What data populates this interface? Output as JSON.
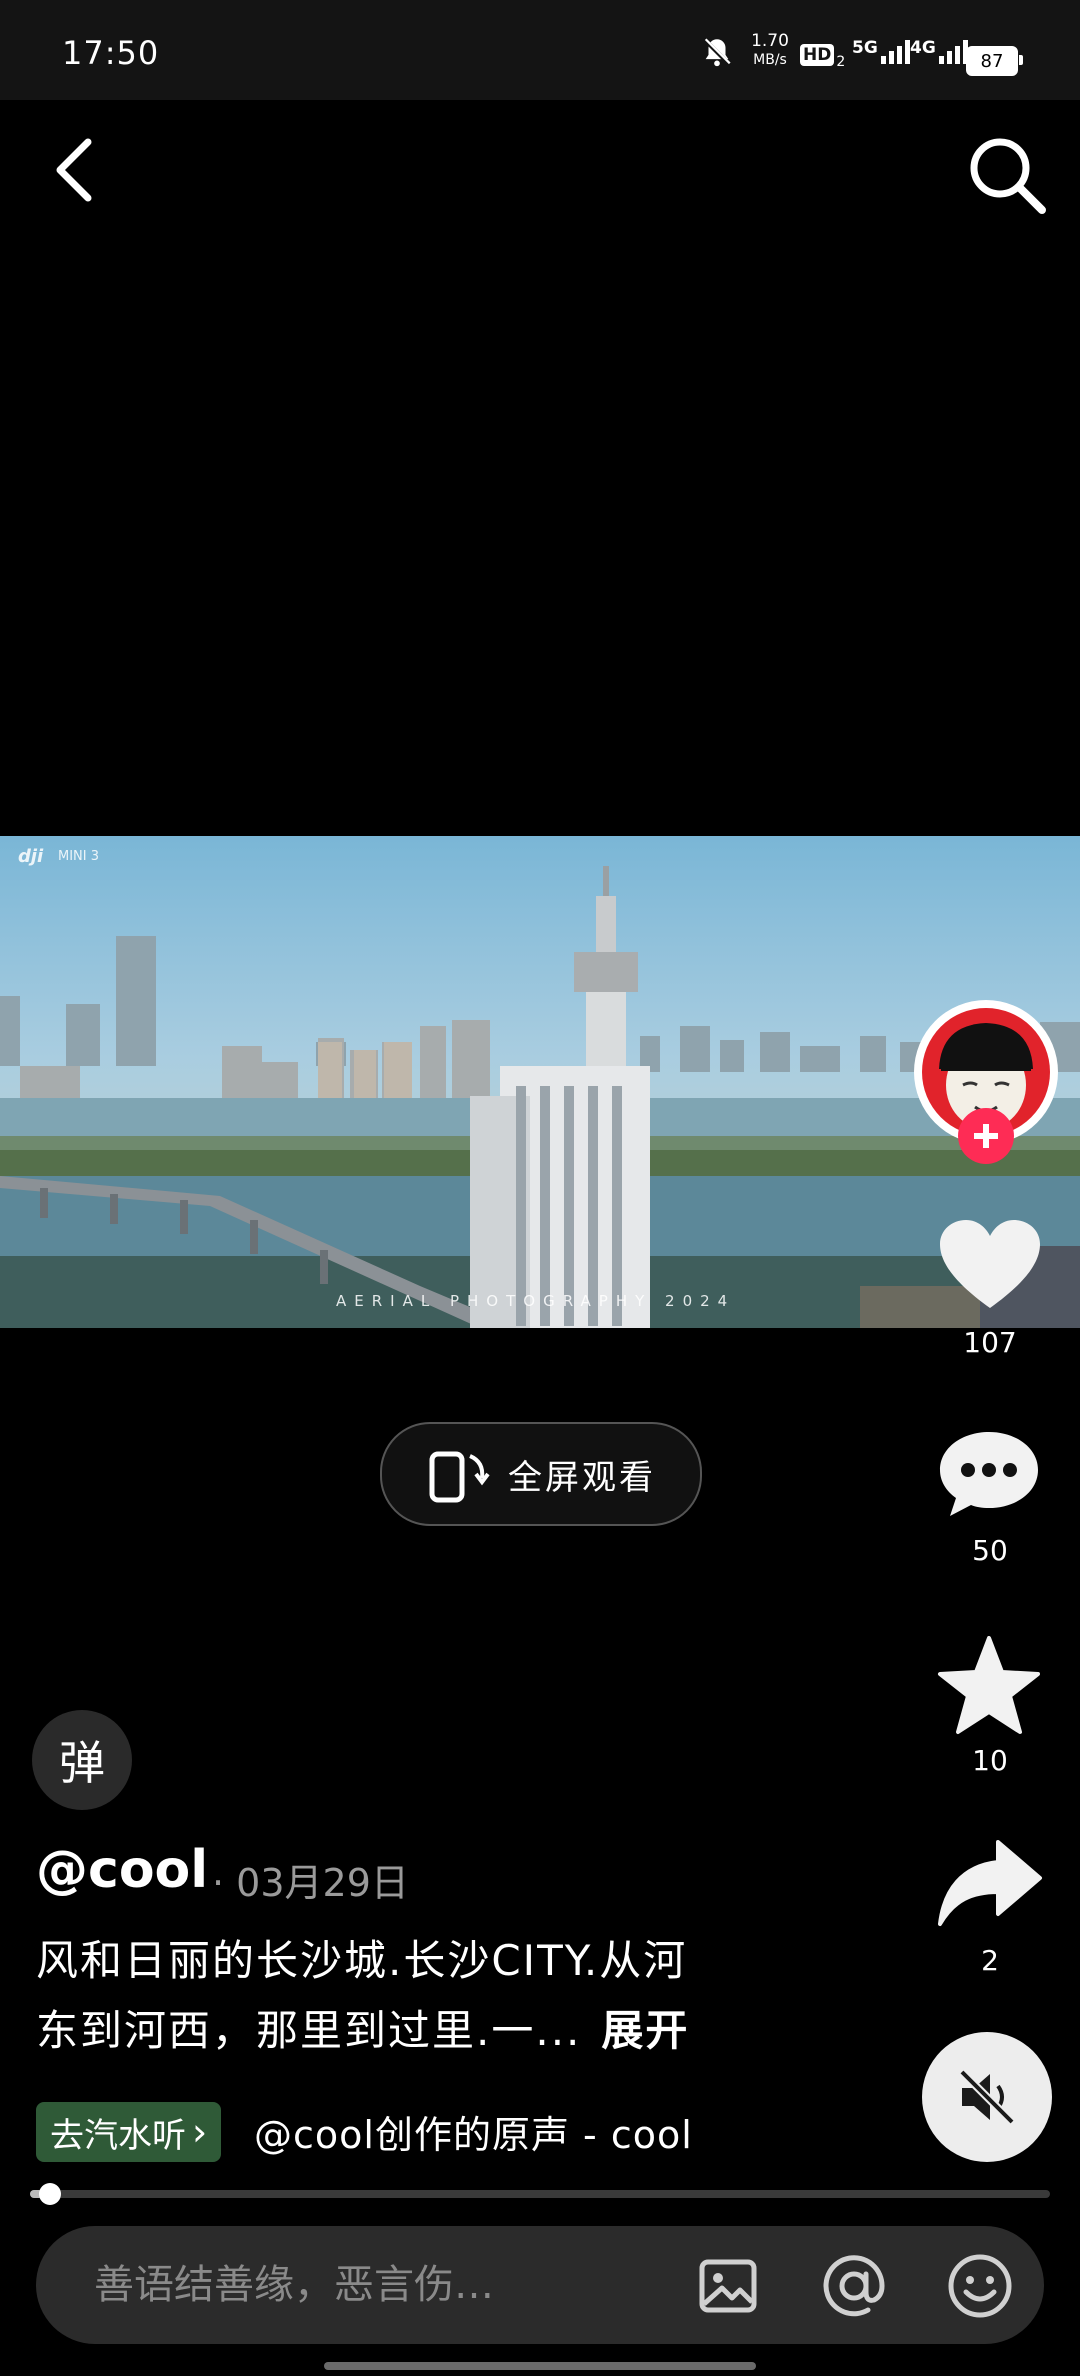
{
  "status_bar": {
    "time": "17:50",
    "net_speed_value": "1.70",
    "net_speed_unit": "MB/s",
    "hd_label": "HD",
    "hd_sub": "2",
    "net1_label": "5G",
    "net2_label": "4G",
    "battery": "87",
    "icons": [
      "bell-off-icon",
      "signal-icon",
      "battery-icon"
    ]
  },
  "nav": {
    "back_icon": "back-arrow-icon",
    "search_icon": "search-icon"
  },
  "video": {
    "brand_logo": "dji",
    "model": "MINI 3",
    "watermark": "AERIAL PHOTOGRAPHY 2024"
  },
  "actions": {
    "likes": "107",
    "comments": "50",
    "favorites": "10",
    "shares": "2"
  },
  "fullscreen_label": "全屏观看",
  "danmaku_label": "弹",
  "post": {
    "author": "@cool",
    "date": "· 03月29日",
    "caption_line1": "风和日丽的长沙城.长沙CITY.从河",
    "caption_line2": "东到河西，那里到过里.一...",
    "expand": "展开"
  },
  "music": {
    "tag_label": "去汽水听",
    "tag_chevron": "›",
    "credit": "@cool创作的原声 - cool"
  },
  "progress": {
    "fraction": 0.013
  },
  "comment": {
    "placeholder": "善语结善缘，恶言伤…",
    "icons": [
      "image-icon",
      "at-icon",
      "emoji-icon"
    ]
  },
  "colors": {
    "follow_plus": "#fe2c55",
    "music_tag_bg": "#2f5a37"
  }
}
